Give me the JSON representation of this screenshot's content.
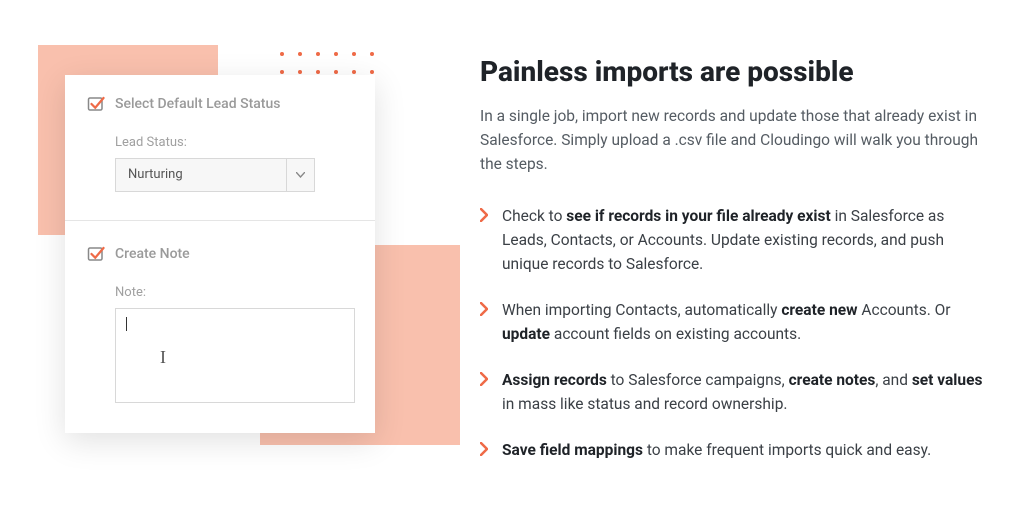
{
  "form": {
    "section1": {
      "title": "Select Default Lead Status",
      "field_label": "Lead Status:",
      "selected_value": "Nurturing"
    },
    "section2": {
      "title": "Create Note",
      "field_label": "Note:"
    }
  },
  "content": {
    "heading": "Painless imports are possible",
    "intro": "In a single job, import new records and update those that already exist in Salesforce. Simply upload a .csv file and Cloudingo will walk you through the steps.",
    "bullets": [
      {
        "pre": "Check to ",
        "b1": "see if records in your file already exist",
        "post": " in Salesforce as Leads, Contacts, or Accounts. Update existing records, and push unique records to Salesforce."
      },
      {
        "pre": "When importing Contacts, automatically ",
        "b1": "create new",
        "mid1": " Accounts. Or ",
        "b2": "update",
        "post": " account fields on existing accounts."
      },
      {
        "b1": "Assign records",
        "mid1": " to Salesforce campaigns, ",
        "b2": "create notes",
        "mid2": ", and ",
        "b3": "set values",
        "post": " in mass like status and record ownership."
      },
      {
        "b1": "Save field mappings",
        "post": " to make frequent imports quick and easy."
      }
    ]
  }
}
